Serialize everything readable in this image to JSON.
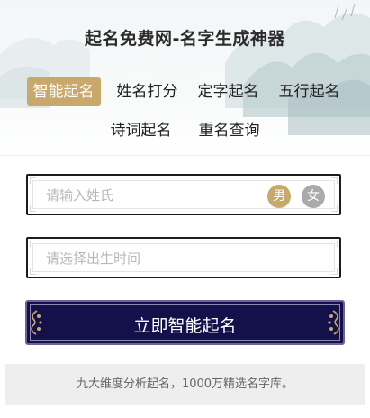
{
  "header": {
    "title": "起名免费网-名字生成神器"
  },
  "nav": {
    "row1": [
      {
        "label": "智能起名",
        "active": true
      },
      {
        "label": "姓名打分",
        "active": false
      },
      {
        "label": "定字起名",
        "active": false
      },
      {
        "label": "五行起名",
        "active": false
      }
    ],
    "row2": [
      {
        "label": "诗词起名",
        "active": false
      },
      {
        "label": "重名查询",
        "active": false
      }
    ]
  },
  "form": {
    "surname_placeholder": "请输入姓氏",
    "surname_value": "",
    "gender_male": "男",
    "gender_female": "女",
    "selected_gender": "男",
    "birth_placeholder": "请选择出生时间",
    "birth_value": "",
    "submit_label": "立即智能起名"
  },
  "footer": {
    "note": "九大维度分析起名，1000万精选名字库。"
  },
  "colors": {
    "accent_gold": "#c9a86b",
    "button_navy": "#14104a",
    "female_gray": "#aaaaaa"
  }
}
